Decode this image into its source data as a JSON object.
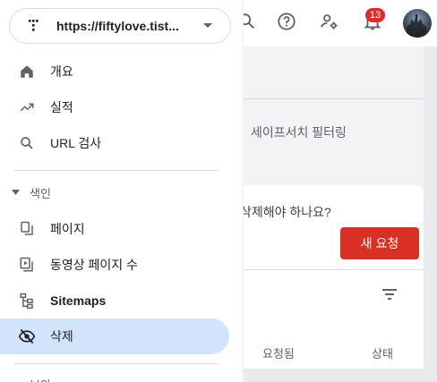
{
  "property": {
    "url": "https://fiftylove.tist...",
    "icon": "property-grid-icon"
  },
  "sidebar": {
    "items": [
      {
        "label": "개요",
        "icon": "home-icon"
      },
      {
        "label": "실적",
        "icon": "trending-up-icon"
      },
      {
        "label": "URL 검사",
        "icon": "search-icon"
      }
    ],
    "index_section": {
      "label": "색인"
    },
    "index_items": [
      {
        "label": "페이지",
        "icon": "pages-icon"
      },
      {
        "label": "동영상 페이지 수",
        "icon": "video-page-icon"
      },
      {
        "label": "Sitemaps",
        "icon": "sitemap-icon"
      },
      {
        "label": "삭제",
        "icon": "eye-off-icon",
        "active": true
      }
    ],
    "cut_label": "보안"
  },
  "header": {
    "notification_count": "13"
  },
  "main": {
    "safe_search": "세이프서치 필터링",
    "question": "삭제해야 하나요?",
    "new_request": "새 요청",
    "columns": {
      "requested": "요청됨",
      "status": "상태"
    }
  },
  "colors": {
    "accent_red": "#d93025",
    "active_bg": "#d2e3fc"
  }
}
